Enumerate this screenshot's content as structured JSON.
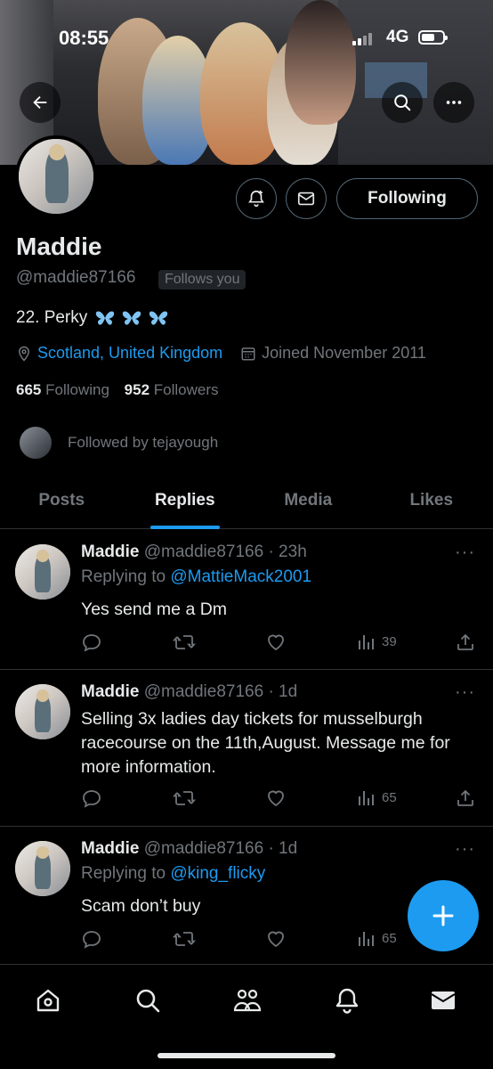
{
  "status_bar": {
    "time": "08:55",
    "network": "4G"
  },
  "header": {
    "back_icon": "arrow-left-icon",
    "search_icon": "search-icon",
    "more_icon": "more-dots-icon"
  },
  "profile": {
    "name": "Maddie",
    "handle": "@maddie87166",
    "follows_you": "Follows you",
    "bio": "22. Perky",
    "bio_emoji": [
      "🦋",
      "🦋",
      "🦋"
    ],
    "location": "Scotland, United Kingdom",
    "joined": "Joined November 2011",
    "following_count": "665",
    "following_label": "Following",
    "followers_count": "952",
    "followers_label": "Followers",
    "followed_by": "Followed by tejayough",
    "follow_button": "Following"
  },
  "tabs": [
    {
      "label": "Posts"
    },
    {
      "label": "Replies",
      "active": true
    },
    {
      "label": "Media"
    },
    {
      "label": "Likes"
    }
  ],
  "posts": [
    {
      "name": "Maddie",
      "handle_time": "@maddie87166 · 23h",
      "replying_prefix": "Replying to",
      "replying_to": "@MattieMack2001",
      "text": "Yes send me a Dm",
      "views": "39"
    },
    {
      "name": "Maddie",
      "handle_time": "@maddie87166 · 1d",
      "text": "Selling 3x ladies day tickets for musselburgh racecourse on the 11th,August. Message me for more information.",
      "views": "65"
    },
    {
      "name": "Maddie",
      "handle_time": "@maddie87166 · 1d",
      "replying_prefix": "Replying to",
      "replying_to": "@king_flicky",
      "text": "Scam don’t buy",
      "views": "65"
    }
  ],
  "colors": {
    "accent": "#1d9bf0",
    "background": "#000000",
    "text_primary": "#e7e9ea",
    "text_secondary": "#71767b",
    "divider": "#2f3336"
  },
  "bottom_nav": [
    "home-icon",
    "search-icon",
    "communities-icon",
    "notifications-icon",
    "messages-icon"
  ]
}
